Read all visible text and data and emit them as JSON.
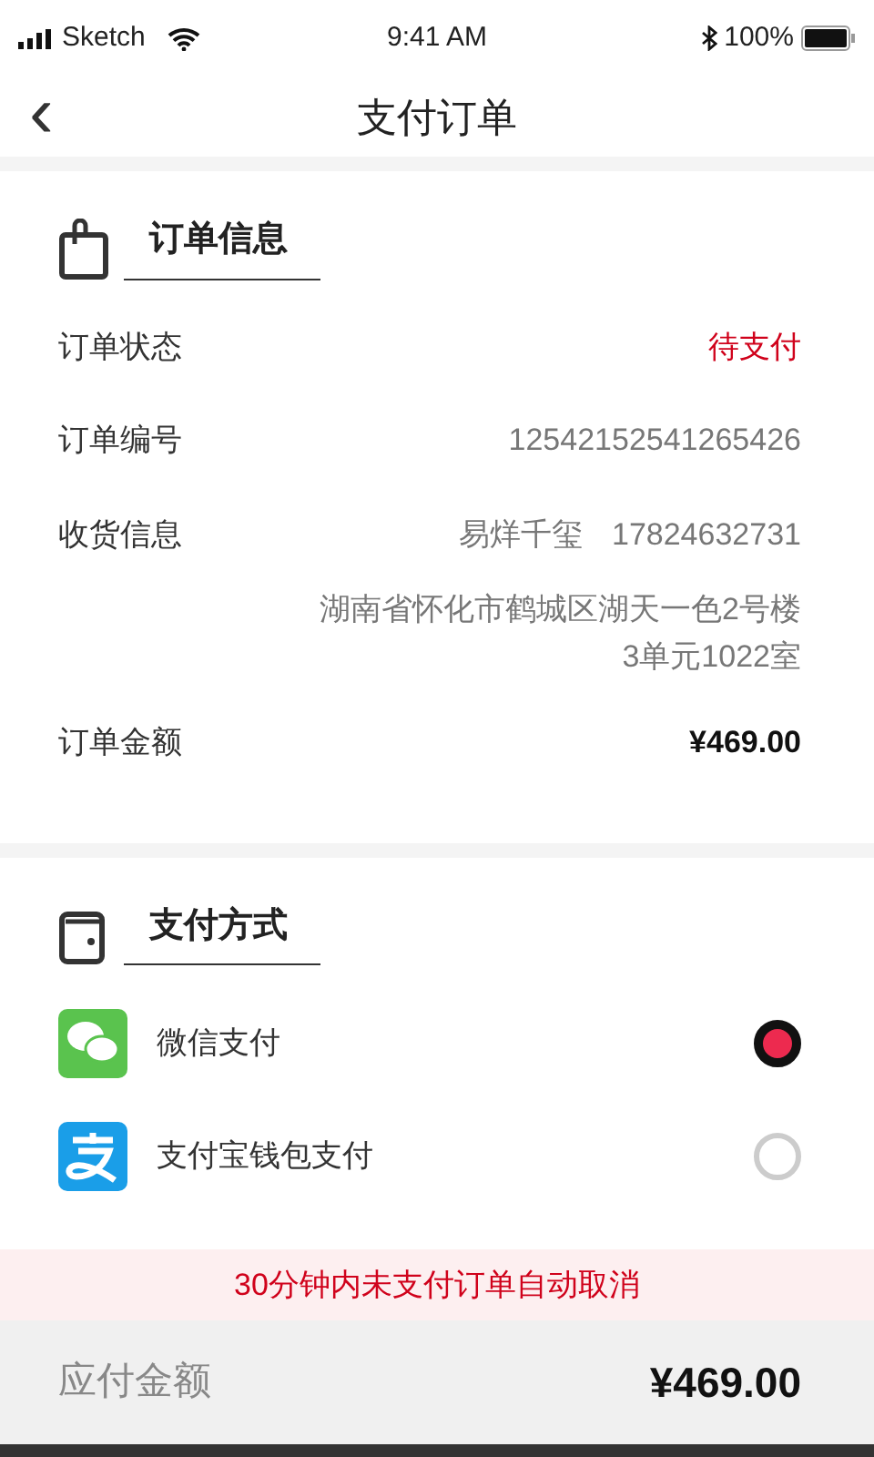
{
  "status_bar": {
    "carrier": "Sketch",
    "time": "9:41 AM",
    "battery": "100%"
  },
  "nav": {
    "back": "‹",
    "title": "支付订单"
  },
  "order_info": {
    "title": "订单信息",
    "rows": [
      {
        "kind": "status",
        "label": "订单状态",
        "value": "待支付"
      },
      {
        "kind": "plain",
        "label": "订单编号",
        "value": "12542152541265426"
      },
      {
        "kind": "address",
        "label": "收货信息",
        "name": "易烊千玺",
        "phone": "17824632731",
        "address_lines": [
          "湖南省怀化市鹤城区湖天一色2号楼",
          "3单元1022室"
        ]
      },
      {
        "kind": "amount",
        "label": "订单金额",
        "value": "¥469.00"
      }
    ]
  },
  "payment": {
    "title": "支付方式",
    "methods": [
      {
        "kind": "wechat",
        "label": "微信支付",
        "selected": true
      },
      {
        "kind": "alipay",
        "label": "支付宝钱包支付",
        "selected": false
      }
    ]
  },
  "notice": "30分钟内未支付订单自动取消",
  "total": {
    "label": "应付金额",
    "value": "¥469.00"
  }
}
